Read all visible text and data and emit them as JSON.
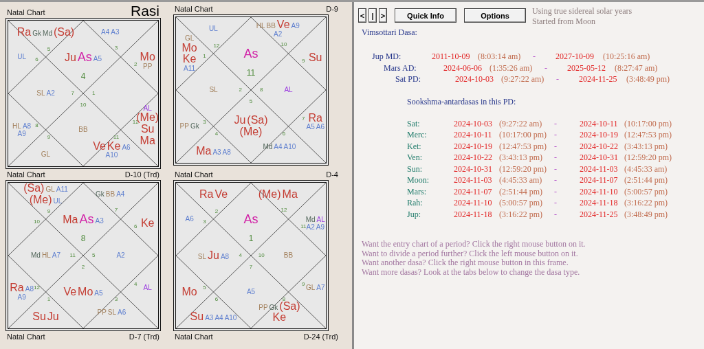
{
  "charts": [
    {
      "label": "Natal Chart",
      "division": "Rasi",
      "large": true,
      "houses": [
        {
          "sign": "4",
          "items": [
            {
              "text": "Ju",
              "kind": "planet"
            },
            {
              "text": "As",
              "kind": "ascendant"
            },
            {
              "text": "A5",
              "kind": "arudha"
            }
          ]
        },
        {
          "sign": "5",
          "items": [
            {
              "text": "Ra",
              "kind": "planet"
            },
            {
              "text": "Gk",
              "kind": "upagraha"
            },
            {
              "text": "Md",
              "kind": "upagraha"
            },
            {
              "text": "(Sa)",
              "kind": "planet"
            }
          ]
        },
        {
          "sign": "6",
          "items": [
            {
              "text": "UL",
              "kind": "arudha"
            }
          ]
        },
        {
          "sign": "7",
          "items": [
            {
              "text": "SL",
              "kind": "lagna"
            },
            {
              "text": "A2",
              "kind": "arudha"
            }
          ]
        },
        {
          "sign": "8",
          "items": [
            {
              "text": "HL",
              "kind": "lagna"
            },
            {
              "text": "A8",
              "kind": "arudha"
            },
            {
              "text": "A9",
              "kind": "arudha"
            }
          ]
        },
        {
          "sign": "9",
          "items": [
            {
              "text": "GL",
              "kind": "lagna"
            }
          ]
        },
        {
          "sign": "10",
          "items": [
            {
              "text": "BB",
              "kind": "lagna"
            }
          ]
        },
        {
          "sign": "11",
          "items": [
            {
              "text": "Ve",
              "kind": "planet"
            },
            {
              "text": "Ke",
              "kind": "planet"
            },
            {
              "text": "A6",
              "kind": "arudha"
            },
            {
              "text": "A10",
              "kind": "arudha"
            }
          ]
        },
        {
          "sign": "12",
          "items": [
            {
              "text": "AL",
              "kind": "al"
            },
            {
              "text": "(Me)",
              "kind": "planet"
            },
            {
              "text": "Su",
              "kind": "planet"
            },
            {
              "text": "Ma",
              "kind": "planet"
            }
          ]
        },
        {
          "sign": "1"
        },
        {
          "sign": "2",
          "items": [
            {
              "text": "Mo",
              "kind": "planet"
            },
            {
              "text": "PP",
              "kind": "lagna"
            }
          ]
        },
        {
          "sign": "3",
          "items": [
            {
              "text": "A4",
              "kind": "arudha"
            },
            {
              "text": "A3",
              "kind": "arudha"
            }
          ]
        }
      ]
    },
    {
      "label": "Natal Chart",
      "division": "D-9",
      "large": false,
      "houses": [
        {
          "sign": "11",
          "items": [
            {
              "text": "As",
              "kind": "ascendant"
            }
          ]
        },
        {
          "sign": "12",
          "items": [
            {
              "text": "UL",
              "kind": "arudha"
            }
          ]
        },
        {
          "sign": "1",
          "items": [
            {
              "text": "GL",
              "kind": "lagna"
            },
            {
              "text": "Mo",
              "kind": "planet"
            },
            {
              "text": "Ke",
              "kind": "planet"
            },
            {
              "text": "A11",
              "kind": "arudha"
            }
          ]
        },
        {
          "sign": "2",
          "items": [
            {
              "text": "SL",
              "kind": "lagna"
            }
          ]
        },
        {
          "sign": "3",
          "items": [
            {
              "text": "PP",
              "kind": "lagna"
            },
            {
              "text": "Gk",
              "kind": "upagraha"
            }
          ]
        },
        {
          "sign": "4",
          "items": [
            {
              "text": "Ma",
              "kind": "planet"
            },
            {
              "text": "A3",
              "kind": "arudha"
            },
            {
              "text": "A8",
              "kind": "arudha"
            }
          ]
        },
        {
          "sign": "5",
          "items": [
            {
              "text": "Ju",
              "kind": "planet"
            },
            {
              "text": "(Sa)",
              "kind": "planet"
            },
            {
              "text": "(Me)",
              "kind": "planet"
            }
          ]
        },
        {
          "sign": "6",
          "items": [
            {
              "text": "Md",
              "kind": "upagraha"
            },
            {
              "text": "A4",
              "kind": "arudha"
            },
            {
              "text": "A10",
              "kind": "arudha"
            }
          ]
        },
        {
          "sign": "7",
          "items": [
            {
              "text": "Ra",
              "kind": "planet"
            },
            {
              "text": "A5",
              "kind": "arudha"
            },
            {
              "text": "A6",
              "kind": "arudha"
            }
          ]
        },
        {
          "sign": "8",
          "items": [
            {
              "text": "AL",
              "kind": "al"
            }
          ]
        },
        {
          "sign": "9",
          "items": [
            {
              "text": "Su",
              "kind": "planet"
            }
          ]
        },
        {
          "sign": "10",
          "items": [
            {
              "text": "HL",
              "kind": "lagna"
            },
            {
              "text": "BB",
              "kind": "lagna"
            },
            {
              "text": "Ve",
              "kind": "planet"
            },
            {
              "text": "A9",
              "kind": "arudha"
            },
            {
              "text": "A2",
              "kind": "arudha"
            }
          ]
        }
      ]
    },
    {
      "label": "Natal Chart",
      "division": "D-10 (Trd)",
      "large": false,
      "houses": [
        {
          "sign": "8",
          "items": [
            {
              "text": "Ma",
              "kind": "planet"
            },
            {
              "text": "As",
              "kind": "ascendant"
            },
            {
              "text": "A3",
              "kind": "arudha"
            }
          ]
        },
        {
          "sign": "9",
          "items": [
            {
              "text": "(Sa)",
              "kind": "planet"
            },
            {
              "text": "GL",
              "kind": "lagna"
            },
            {
              "text": "A11",
              "kind": "arudha"
            },
            {
              "text": "(Me)",
              "kind": "planet"
            },
            {
              "text": "UL",
              "kind": "arudha"
            }
          ]
        },
        {
          "sign": "10"
        },
        {
          "sign": "11",
          "items": [
            {
              "text": "Md",
              "kind": "upagraha"
            },
            {
              "text": "HL",
              "kind": "lagna"
            },
            {
              "text": "A7",
              "kind": "arudha"
            }
          ]
        },
        {
          "sign": "12",
          "items": [
            {
              "text": "Ra",
              "kind": "planet"
            },
            {
              "text": "A8",
              "kind": "arudha"
            },
            {
              "text": "A9",
              "kind": "arudha"
            }
          ]
        },
        {
          "sign": "1",
          "items": [
            {
              "text": "Su",
              "kind": "planet"
            },
            {
              "text": "Ju",
              "kind": "planet"
            }
          ]
        },
        {
          "sign": "2",
          "items": [
            {
              "text": "Ve",
              "kind": "planet"
            },
            {
              "text": "Mo",
              "kind": "planet"
            },
            {
              "text": "A5",
              "kind": "arudha"
            }
          ]
        },
        {
          "sign": "3",
          "items": [
            {
              "text": "PP",
              "kind": "lagna"
            },
            {
              "text": "SL",
              "kind": "lagna"
            },
            {
              "text": "A6",
              "kind": "arudha"
            }
          ]
        },
        {
          "sign": "4",
          "items": [
            {
              "text": "AL",
              "kind": "al"
            }
          ]
        },
        {
          "sign": "5",
          "items": [
            {
              "text": "A2",
              "kind": "arudha"
            }
          ]
        },
        {
          "sign": "6",
          "items": [
            {
              "text": "Ke",
              "kind": "planet"
            }
          ]
        },
        {
          "sign": "7",
          "items": [
            {
              "text": "Gk",
              "kind": "upagraha"
            },
            {
              "text": "BB",
              "kind": "lagna"
            },
            {
              "text": "A4",
              "kind": "arudha"
            }
          ]
        }
      ]
    },
    {
      "label": "Natal Chart",
      "division": "D-4",
      "large": false,
      "houses": [
        {
          "sign": "1",
          "items": [
            {
              "text": "As",
              "kind": "ascendant"
            }
          ]
        },
        {
          "sign": "2",
          "items": [
            {
              "text": "Ra",
              "kind": "planet"
            },
            {
              "text": "Ve",
              "kind": "planet"
            }
          ]
        },
        {
          "sign": "3",
          "items": [
            {
              "text": "A6",
              "kind": "arudha"
            }
          ]
        },
        {
          "sign": "4",
          "items": [
            {
              "text": "SL",
              "kind": "lagna"
            },
            {
              "text": "Ju",
              "kind": "planet"
            },
            {
              "text": "A8",
              "kind": "arudha"
            }
          ]
        },
        {
          "sign": "5",
          "items": [
            {
              "text": "Mo",
              "kind": "planet"
            }
          ]
        },
        {
          "sign": "6",
          "items": [
            {
              "text": "Su",
              "kind": "planet"
            },
            {
              "text": "A3",
              "kind": "arudha"
            },
            {
              "text": "A4",
              "kind": "arudha"
            },
            {
              "text": "A10",
              "kind": "arudha"
            }
          ]
        },
        {
          "sign": "7",
          "items": [
            {
              "text": "A5",
              "kind": "arudha"
            }
          ]
        },
        {
          "sign": "8",
          "items": [
            {
              "text": "PP",
              "kind": "lagna"
            },
            {
              "text": "Gk",
              "kind": "upagraha"
            },
            {
              "text": "(Sa)",
              "kind": "planet"
            },
            {
              "text": "Ke",
              "kind": "planet"
            }
          ]
        },
        {
          "sign": "9",
          "items": [
            {
              "text": "GL",
              "kind": "lagna"
            },
            {
              "text": "A7",
              "kind": "arudha"
            }
          ]
        },
        {
          "sign": "10",
          "items": [
            {
              "text": "BB",
              "kind": "lagna"
            }
          ]
        },
        {
          "sign": "11",
          "items": [
            {
              "text": "Md",
              "kind": "upagraha"
            },
            {
              "text": "AL",
              "kind": "al"
            },
            {
              "text": "A2",
              "kind": "arudha"
            },
            {
              "text": "A9",
              "kind": "arudha"
            }
          ]
        },
        {
          "sign": "12",
          "items": [
            {
              "text": "(Me)",
              "kind": "planet"
            },
            {
              "text": "Ma",
              "kind": "planet"
            }
          ]
        }
      ]
    },
    {
      "label": "Natal Chart",
      "division": "D-7 (Trd)",
      "large": false
    },
    {
      "label": "Natal Chart",
      "division": "D-24 (Trd)",
      "large": false
    }
  ],
  "toolbar": {
    "nav": [
      "<",
      "|",
      ">"
    ],
    "buttons": [
      "Quick Info",
      "Options"
    ],
    "notes": [
      "Using true sidereal solar years",
      "Started from Moon"
    ]
  },
  "dasa": {
    "title": "Vimsottari Dasa:",
    "periods": [
      {
        "label": "Jup MD:",
        "start_date": "2011-10-09",
        "start_time": "(8:03:14 am)",
        "sep": "-",
        "end_date": "2027-10-09",
        "end_time": "(10:25:16 am)",
        "children": [
          {
            "label": "Mars AD:",
            "start_date": "2024-06-06",
            "start_time": "(1:35:26 am)",
            "sep": "-",
            "end_date": "2025-05-12",
            "end_time": "(8:27:47 am)",
            "children": [
              {
                "label": "Sat PD:",
                "start_date": "2024-10-03",
                "start_time": "(9:27:22 am)",
                "sep": "-",
                "end_date": "2024-11-25",
                "end_time": "(3:48:49 pm)"
              }
            ]
          }
        ]
      }
    ]
  },
  "sookshma": {
    "title": "Sookshma-antardasas in this PD:",
    "rows": [
      {
        "label": "Sat:",
        "start_date": "2024-10-03",
        "start_time": "(9:27:22 am)",
        "sep": "-",
        "end_date": "2024-10-11",
        "end_time": "(10:17:00 pm)"
      },
      {
        "label": "Merc:",
        "start_date": "2024-10-11",
        "start_time": "(10:17:00 pm)",
        "sep": "-",
        "end_date": "2024-10-19",
        "end_time": "(12:47:53 pm)"
      },
      {
        "label": "Ket:",
        "start_date": "2024-10-19",
        "start_time": "(12:47:53 pm)",
        "sep": "-",
        "end_date": "2024-10-22",
        "end_time": "(3:43:13 pm)"
      },
      {
        "label": "Ven:",
        "start_date": "2024-10-22",
        "start_time": "(3:43:13 pm)",
        "sep": "-",
        "end_date": "2024-10-31",
        "end_time": "(12:59:20 pm)"
      },
      {
        "label": "Sun:",
        "start_date": "2024-10-31",
        "start_time": "(12:59:20 pm)",
        "sep": "-",
        "end_date": "2024-11-03",
        "end_time": "(4:45:33 am)"
      },
      {
        "label": "Moon:",
        "start_date": "2024-11-03",
        "start_time": "(4:45:33 am)",
        "sep": "-",
        "end_date": "2024-11-07",
        "end_time": "(2:51:44 pm)"
      },
      {
        "label": "Mars:",
        "start_date": "2024-11-07",
        "start_time": "(2:51:44 pm)",
        "sep": "-",
        "end_date": "2024-11-10",
        "end_time": "(5:00:57 pm)"
      },
      {
        "label": "Rah:",
        "start_date": "2024-11-10",
        "start_time": "(5:00:57 pm)",
        "sep": "-",
        "end_date": "2024-11-18",
        "end_time": "(3:16:22 pm)"
      },
      {
        "label": "Jup:",
        "start_date": "2024-11-18",
        "start_time": "(3:16:22 pm)",
        "sep": "-",
        "end_date": "2024-11-25",
        "end_time": "(3:48:49 pm)"
      }
    ]
  },
  "help": [
    "Want the entry chart of a period? Click the right mouse button on it.",
    "Want to divide a period further? Click the left mouse button on it.",
    "Want another dasa? Click the right mouse button in this frame.",
    "Want more dasas? Look at the tabs below to change the dasa type."
  ]
}
